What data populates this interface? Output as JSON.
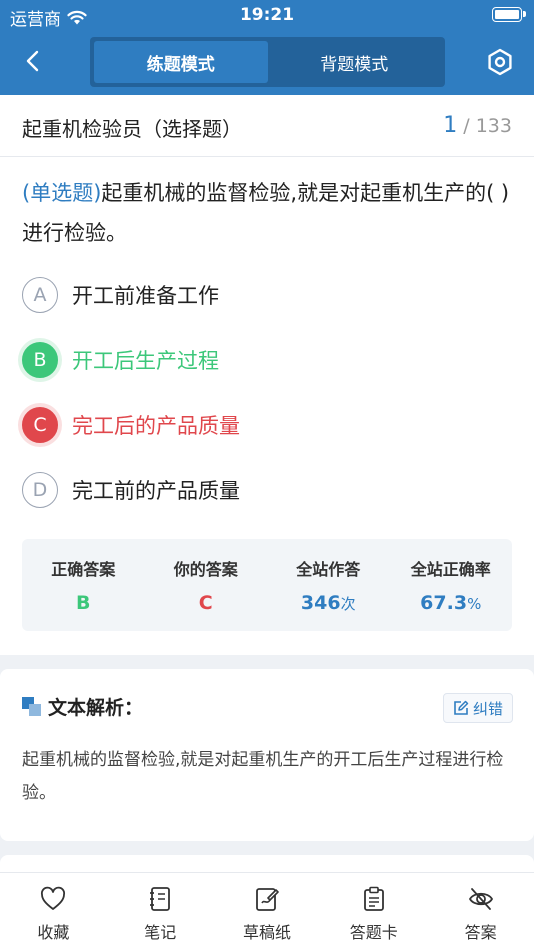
{
  "status": {
    "carrier": "运营商",
    "time": "19:21"
  },
  "nav": {
    "modes": [
      "练题模式",
      "背题模式"
    ]
  },
  "question": {
    "title": "起重机检验员（选择题）",
    "current": "1",
    "total": "/ 133",
    "type_tag": "(单选题)",
    "text": "起重机械的监督检验,就是对起重机生产的(      )进行检验。",
    "options": [
      {
        "letter": "A",
        "text": "开工前准备工作",
        "state": "normal"
      },
      {
        "letter": "B",
        "text": "开工后生产过程",
        "state": "correct"
      },
      {
        "letter": "C",
        "text": "完工后的产品质量",
        "state": "wrong"
      },
      {
        "letter": "D",
        "text": "完工前的产品质量",
        "state": "normal"
      }
    ]
  },
  "stats": {
    "correct_label": "正确答案",
    "correct_value": "B",
    "yours_label": "你的答案",
    "yours_value": "C",
    "attempts_label": "全站作答",
    "attempts_value": "346",
    "attempts_unit": "次",
    "rate_label": "全站正确率",
    "rate_value": "67.3",
    "rate_unit": "%"
  },
  "analysis": {
    "title": "文本解析：",
    "report_label": "纠错",
    "text": "起重机械的监督检验,就是对起重机生产的开工后生产过程进行检验。"
  },
  "toolbar": {
    "favorite": "收藏",
    "notes": "笔记",
    "draft": "草稿纸",
    "answer_card": "答题卡",
    "answer": "答案"
  },
  "colors": {
    "primary": "#2f7dc1",
    "correct": "#3cc77a",
    "wrong": "#e0474c"
  }
}
